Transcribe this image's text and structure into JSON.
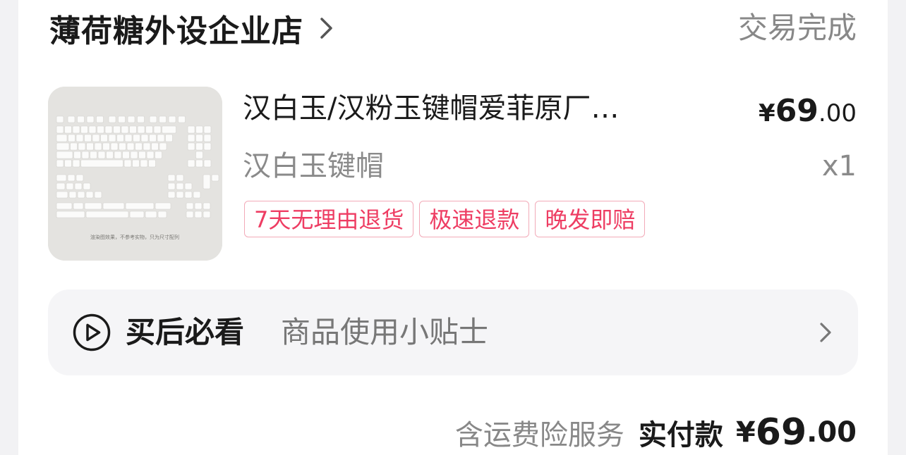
{
  "shop": {
    "name": "薄荷糖外设企业店",
    "chevron_icon": "chevron-right-icon"
  },
  "order": {
    "status": "交易完成"
  },
  "product": {
    "image_icon": "keyboard-keycaps-image",
    "image_caption": "渲染图效果，不参考实物，只为尺寸配列",
    "title": "汉白玉/汉粉玉键帽爱菲原厂…",
    "price_symbol": "¥",
    "price_integer": "69",
    "price_decimal": ".00",
    "sku": "汉白玉键帽",
    "quantity": "x1",
    "tags": [
      {
        "label": "7天无理由退货"
      },
      {
        "label": "极速退款"
      },
      {
        "label": "晚发即赔"
      }
    ],
    "tag_color": "#ee3d63",
    "tag_border_color": "#f2aab8"
  },
  "tips": {
    "icon": "play-circle-icon",
    "title": "买后必看",
    "subtitle": "商品使用小贴士",
    "chevron_icon": "chevron-right-icon"
  },
  "total": {
    "shipping_insurance": "含运费险服务",
    "paid_label": "实付款",
    "symbol": "¥",
    "integer": "69",
    "decimal": ".00"
  }
}
